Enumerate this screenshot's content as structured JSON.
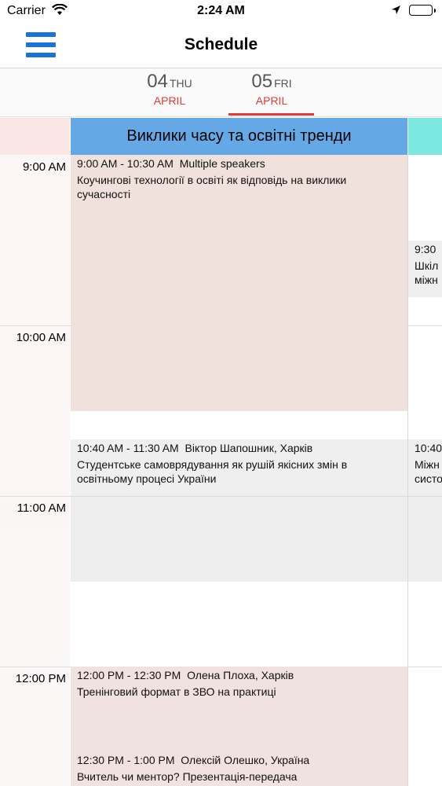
{
  "status_bar": {
    "carrier": "Carrier",
    "time": "2:24 AM"
  },
  "nav": {
    "title": "Schedule",
    "menu_icon": "hamburger-menu-icon"
  },
  "days": [
    {
      "num": "04",
      "weekday": "THU",
      "month": "APRIL",
      "selected": false
    },
    {
      "num": "05",
      "weekday": "FRI",
      "month": "APRIL",
      "selected": true
    }
  ],
  "hours": [
    "9:00 AM",
    "10:00 AM",
    "11:00 AM",
    "12:00 PM"
  ],
  "tracks": [
    {
      "title": "Виклики часу та освітні тренди",
      "color": "#64a9e6",
      "events": [
        {
          "time": "9:00 AM - 10:30 AM",
          "speaker": "Multiple speakers",
          "title": "Коучингові технології в освіті як відповідь на виклики сучасності"
        },
        {
          "time": "10:40 AM - 11:30 AM",
          "speaker": "Віктор Шапошник, Харків",
          "title": "Студентське самоврядування як рушій якісних змін в освітньому процесі України"
        },
        {
          "time": "12:00 PM - 12:30 PM",
          "speaker": "Олена Плоха, Харків",
          "title": "Тренінговий формат в ЗВО на практиці"
        },
        {
          "time": "12:30 PM - 1:00 PM",
          "speaker": "Олексій Олешко, Україна",
          "title": "Вчитель чи ментор? Презентація-передача"
        }
      ]
    },
    {
      "title": "",
      "color": "#7ce8e0",
      "events": [
        {
          "time": "9:30",
          "title": "Шкіл міжн"
        },
        {
          "time": "10:40",
          "title": "Міжн систо"
        }
      ]
    }
  ],
  "colors": {
    "accent_blue": "#1a73d6",
    "accent_red": "#e53935",
    "event_bg_1": "#f0e1dd",
    "event_bg_2": "#efefef",
    "event_bg_3": "#f0e2df"
  }
}
